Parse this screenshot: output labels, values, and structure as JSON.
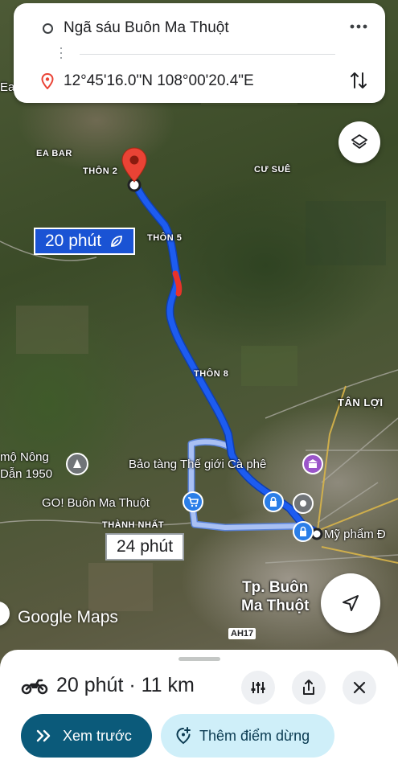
{
  "search": {
    "origin": "Ngã sáu Buôn Ma Thuột",
    "destination": "12°45'16.0\"N 108°00'20.4\"E"
  },
  "map": {
    "labels": {
      "ea": "Ea",
      "ea_bar": "EA BAR",
      "thon_2": "THÔN 2",
      "cu_sue": "CƯ SUÊ",
      "thon_5": "THÔN 5",
      "thon_8": "THÔN 8",
      "tan_loi": "TÂN LỢI",
      "mo_nong_1": "mộ Nông",
      "mo_nong_2": "Dẫn 1950",
      "bao_tang": "Bảo tàng Thế giới Cà phê",
      "go_bmt": "GO! Buôn Ma Thuột",
      "thanh_nhat": "THÀNH NHẤT",
      "my_pham": "Mỹ phẩm Đ",
      "city_line1": "Tp. Buôn",
      "city_line2": "Ma Thuột",
      "highway": "AH17"
    },
    "route_primary_time": "20 phút",
    "route_alt_time": "24 phút",
    "logo": "Google Maps",
    "colors": {
      "route": "#1a53d4",
      "route_alt": "#9bb3ef",
      "traffic": "#e8332a",
      "pin": "#ea4335"
    }
  },
  "sheet": {
    "summary": "20 phút · 11 km",
    "preview_label": "Xem trước",
    "add_stop_label": "Thêm điểm dừng"
  },
  "icons": [
    "circle-icon",
    "more-icon",
    "pin-icon",
    "swap-icon",
    "layers-icon",
    "leaf-icon",
    "museum-icon",
    "shopping-icon",
    "lock-icon",
    "navigate-icon",
    "motorbike-icon",
    "options-icon",
    "share-icon",
    "close-icon",
    "chevrons-icon",
    "add-stop-icon"
  ]
}
